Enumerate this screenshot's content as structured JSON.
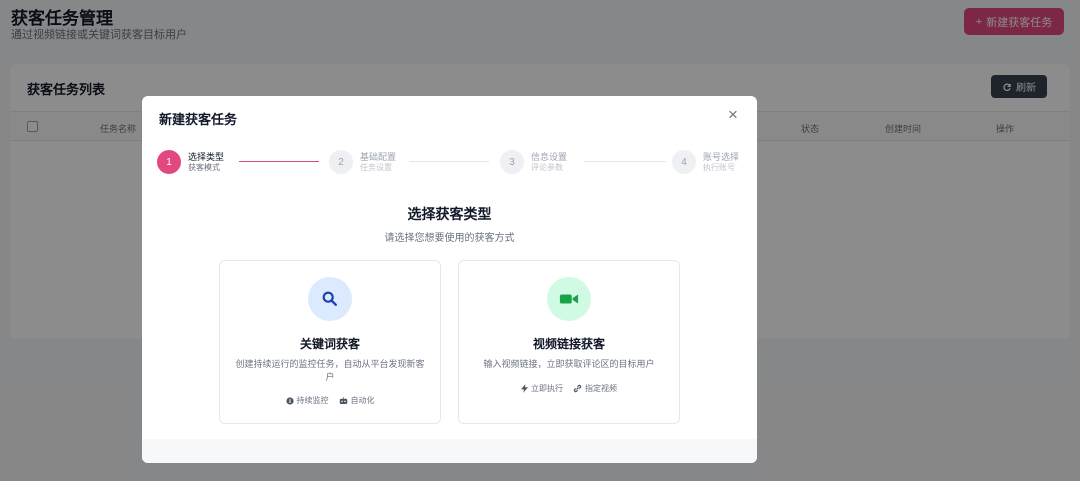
{
  "page": {
    "title": "获客任务管理",
    "subtitle": "通过视频链接或关键词获客目标用户",
    "new_task_label": "新建获客任务",
    "new_task_icon": "+"
  },
  "list": {
    "title": "获客任务列表",
    "refresh_label": "刷新",
    "columns": [
      "任务名称",
      "状态",
      "创建时间",
      "操作"
    ]
  },
  "modal": {
    "title": "新建获客任务",
    "close_glyph": "×",
    "steps": [
      {
        "num": "1",
        "label": "选择类型",
        "sub": "获客模式",
        "active": true
      },
      {
        "num": "2",
        "label": "基础配置",
        "sub": "任务设置",
        "active": false
      },
      {
        "num": "3",
        "label": "信息设置",
        "sub": "评论参数",
        "active": false
      },
      {
        "num": "4",
        "label": "账号选择",
        "sub": "执行账号",
        "active": false
      }
    ],
    "section_title": "选择获客类型",
    "section_subtitle": "请选择您想要使用的获客方式",
    "cards": [
      {
        "title": "关键词获客",
        "desc": "创建持续运行的监控任务，自动从平台发现新客户",
        "icon": "search-icon",
        "icon_bg": "#dbeafe",
        "icon_color": "#1e40af",
        "tags": [
          "持续监控",
          "自动化"
        ]
      },
      {
        "title": "视频链接获客",
        "desc": "输入视频链接，立即获取评论区的目标用户",
        "icon": "video-icon",
        "icon_bg": "#d1fae5",
        "icon_color": "#16a34a",
        "tags": [
          "立即执行",
          "指定视频"
        ]
      }
    ]
  },
  "colors": {
    "accent": "#e2487f",
    "refresh_bg": "#374151"
  }
}
